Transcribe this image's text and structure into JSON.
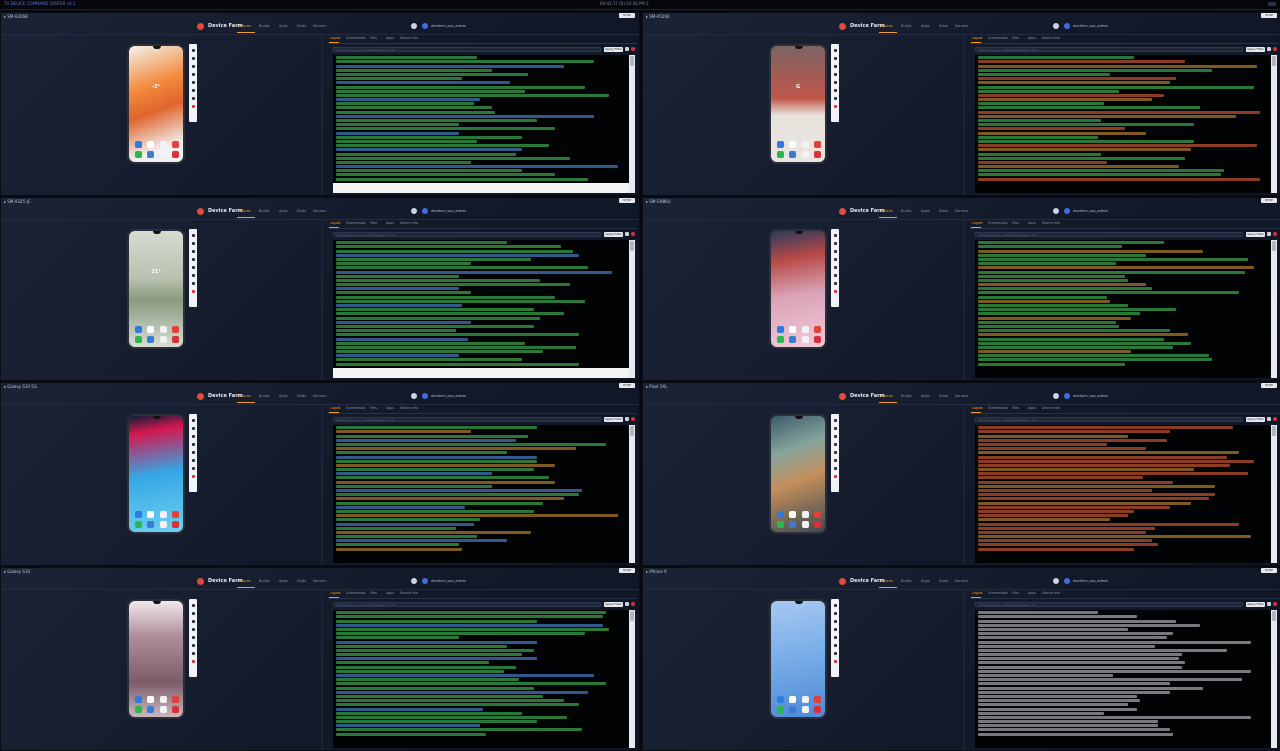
{
  "app": {
    "window_title": "TV DEVICE COMMAND CENTER v4.1",
    "clock": "09:02:17 (0) 02:26 PM 2"
  },
  "common": {
    "brand": "Device Farm",
    "nav": [
      "Devices",
      "Builds",
      "Apps",
      "Stats",
      "Servers"
    ],
    "username": "devfarm_ops_admin",
    "tabs": [
      "Logcat",
      "Screenshots",
      "Files",
      "Apps",
      "Device Info"
    ],
    "filter_placeholder": "Filter logs (e.g., ActivityManager) / Ctrl",
    "apply_label": "Apply Filter",
    "top_button": "STOP DEVICE"
  },
  "tiles": [
    {
      "title": "▸ SM-A326B",
      "phone_theme": "orange",
      "lock_text": "-3°",
      "log_colors": [
        "#4cd964",
        "#4cd964",
        "#5aa0ff",
        "#4cd964"
      ],
      "white_bottom": true
    },
    {
      "title": "▸ SM-A5260",
      "phone_theme": "coral",
      "lock_text": "G",
      "log_colors": [
        "#4cd964",
        "#ff6b3d",
        "#e6a23c",
        "#4cd964"
      ],
      "white_bottom": false
    },
    {
      "title": "▸ SM-A325-JC",
      "phone_theme": "sage",
      "lock_text": "21°",
      "log_colors": [
        "#4cd964",
        "#4cd964",
        "#4cd964",
        "#5aa0ff"
      ],
      "white_bottom": true
    },
    {
      "title": "▸ SM-G986U",
      "phone_theme": "coralreef",
      "lock_text": "",
      "log_colors": [
        "#4cd964",
        "#4cd964",
        "#e6a23c",
        "#4cd964"
      ],
      "white_bottom": false
    },
    {
      "title": "▸ Galaxy S10 5G",
      "phone_theme": "pinkblue",
      "lock_text": "",
      "log_colors": [
        "#4cd964",
        "#e6a23c",
        "#4cd964",
        "#5aa0ff"
      ],
      "white_bottom": false
    },
    {
      "title": "▸ Pixel 3XL",
      "phone_theme": "beach",
      "lock_text": "",
      "log_colors": [
        "#ff6b3d",
        "#ff6b3d",
        "#e6a23c",
        "#ff6b3d"
      ],
      "white_bottom": false
    },
    {
      "title": "▸ Galaxy S10",
      "phone_theme": "mauve",
      "lock_text": "",
      "log_colors": [
        "#4cd964",
        "#4cd964",
        "#4cd964",
        "#5aa0ff"
      ],
      "white_bottom": false
    },
    {
      "title": "▸ iPhone X",
      "phone_theme": "ios",
      "lock_text": "",
      "log_colors": [
        "#d8dbe3",
        "#d8dbe3",
        "#d8dbe3",
        "#d8dbe3"
      ],
      "white_bottom": false
    }
  ]
}
